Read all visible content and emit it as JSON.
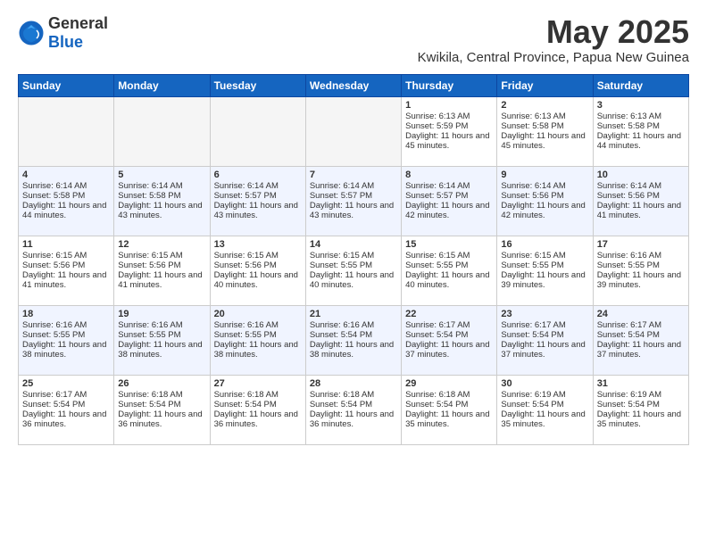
{
  "logo": {
    "general": "General",
    "blue": "Blue"
  },
  "title": "May 2025",
  "subtitle": "Kwikila, Central Province, Papua New Guinea",
  "days_of_week": [
    "Sunday",
    "Monday",
    "Tuesday",
    "Wednesday",
    "Thursday",
    "Friday",
    "Saturday"
  ],
  "weeks": [
    {
      "days": [
        {
          "num": "",
          "empty": true
        },
        {
          "num": "",
          "empty": true
        },
        {
          "num": "",
          "empty": true
        },
        {
          "num": "",
          "empty": true
        },
        {
          "num": "1",
          "sunrise": "6:13 AM",
          "sunset": "5:59 PM",
          "daylight": "11 hours and 45 minutes."
        },
        {
          "num": "2",
          "sunrise": "6:13 AM",
          "sunset": "5:58 PM",
          "daylight": "11 hours and 45 minutes."
        },
        {
          "num": "3",
          "sunrise": "6:13 AM",
          "sunset": "5:58 PM",
          "daylight": "11 hours and 44 minutes."
        }
      ]
    },
    {
      "days": [
        {
          "num": "4",
          "sunrise": "6:14 AM",
          "sunset": "5:58 PM",
          "daylight": "11 hours and 44 minutes."
        },
        {
          "num": "5",
          "sunrise": "6:14 AM",
          "sunset": "5:58 PM",
          "daylight": "11 hours and 43 minutes."
        },
        {
          "num": "6",
          "sunrise": "6:14 AM",
          "sunset": "5:57 PM",
          "daylight": "11 hours and 43 minutes."
        },
        {
          "num": "7",
          "sunrise": "6:14 AM",
          "sunset": "5:57 PM",
          "daylight": "11 hours and 43 minutes."
        },
        {
          "num": "8",
          "sunrise": "6:14 AM",
          "sunset": "5:57 PM",
          "daylight": "11 hours and 42 minutes."
        },
        {
          "num": "9",
          "sunrise": "6:14 AM",
          "sunset": "5:56 PM",
          "daylight": "11 hours and 42 minutes."
        },
        {
          "num": "10",
          "sunrise": "6:14 AM",
          "sunset": "5:56 PM",
          "daylight": "11 hours and 41 minutes."
        }
      ]
    },
    {
      "days": [
        {
          "num": "11",
          "sunrise": "6:15 AM",
          "sunset": "5:56 PM",
          "daylight": "11 hours and 41 minutes."
        },
        {
          "num": "12",
          "sunrise": "6:15 AM",
          "sunset": "5:56 PM",
          "daylight": "11 hours and 41 minutes."
        },
        {
          "num": "13",
          "sunrise": "6:15 AM",
          "sunset": "5:56 PM",
          "daylight": "11 hours and 40 minutes."
        },
        {
          "num": "14",
          "sunrise": "6:15 AM",
          "sunset": "5:55 PM",
          "daylight": "11 hours and 40 minutes."
        },
        {
          "num": "15",
          "sunrise": "6:15 AM",
          "sunset": "5:55 PM",
          "daylight": "11 hours and 40 minutes."
        },
        {
          "num": "16",
          "sunrise": "6:15 AM",
          "sunset": "5:55 PM",
          "daylight": "11 hours and 39 minutes."
        },
        {
          "num": "17",
          "sunrise": "6:16 AM",
          "sunset": "5:55 PM",
          "daylight": "11 hours and 39 minutes."
        }
      ]
    },
    {
      "days": [
        {
          "num": "18",
          "sunrise": "6:16 AM",
          "sunset": "5:55 PM",
          "daylight": "11 hours and 38 minutes."
        },
        {
          "num": "19",
          "sunrise": "6:16 AM",
          "sunset": "5:55 PM",
          "daylight": "11 hours and 38 minutes."
        },
        {
          "num": "20",
          "sunrise": "6:16 AM",
          "sunset": "5:55 PM",
          "daylight": "11 hours and 38 minutes."
        },
        {
          "num": "21",
          "sunrise": "6:16 AM",
          "sunset": "5:54 PM",
          "daylight": "11 hours and 38 minutes."
        },
        {
          "num": "22",
          "sunrise": "6:17 AM",
          "sunset": "5:54 PM",
          "daylight": "11 hours and 37 minutes."
        },
        {
          "num": "23",
          "sunrise": "6:17 AM",
          "sunset": "5:54 PM",
          "daylight": "11 hours and 37 minutes."
        },
        {
          "num": "24",
          "sunrise": "6:17 AM",
          "sunset": "5:54 PM",
          "daylight": "11 hours and 37 minutes."
        }
      ]
    },
    {
      "days": [
        {
          "num": "25",
          "sunrise": "6:17 AM",
          "sunset": "5:54 PM",
          "daylight": "11 hours and 36 minutes."
        },
        {
          "num": "26",
          "sunrise": "6:18 AM",
          "sunset": "5:54 PM",
          "daylight": "11 hours and 36 minutes."
        },
        {
          "num": "27",
          "sunrise": "6:18 AM",
          "sunset": "5:54 PM",
          "daylight": "11 hours and 36 minutes."
        },
        {
          "num": "28",
          "sunrise": "6:18 AM",
          "sunset": "5:54 PM",
          "daylight": "11 hours and 36 minutes."
        },
        {
          "num": "29",
          "sunrise": "6:18 AM",
          "sunset": "5:54 PM",
          "daylight": "11 hours and 35 minutes."
        },
        {
          "num": "30",
          "sunrise": "6:19 AM",
          "sunset": "5:54 PM",
          "daylight": "11 hours and 35 minutes."
        },
        {
          "num": "31",
          "sunrise": "6:19 AM",
          "sunset": "5:54 PM",
          "daylight": "11 hours and 35 minutes."
        }
      ]
    }
  ]
}
